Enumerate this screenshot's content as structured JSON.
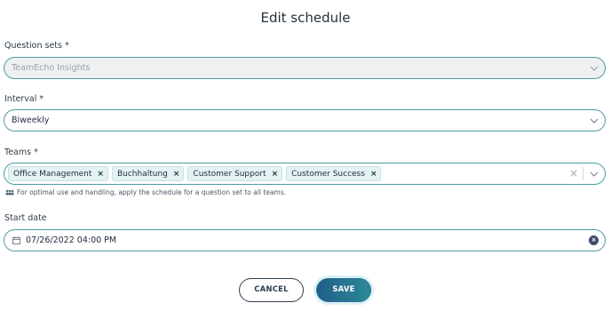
{
  "dialog": {
    "title": "Edit schedule"
  },
  "question_sets": {
    "label": "Question sets *",
    "value": "TeamEcho Insights"
  },
  "interval": {
    "label": "Interval *",
    "value": "Biweekly"
  },
  "teams": {
    "label": "Teams *",
    "chips": [
      "Office Management",
      "Buchhaltung",
      "Customer Support",
      "Customer Success"
    ],
    "remove_glyph": "×",
    "clear_glyph": "×",
    "hint": "For optimal use and handling, apply the schedule for a question set to all teams."
  },
  "start_date": {
    "label": "Start date",
    "value": "07/26/2022 04:00 PM",
    "clear_glyph": "×"
  },
  "actions": {
    "cancel_label": "CANCEL",
    "save_label": "SAVE"
  },
  "colors": {
    "accent_border": "#4a9da3",
    "save_gradient_start": "#1f5e8a",
    "save_gradient_end": "#2c8a94",
    "chip_bg": "#e4f2f3"
  },
  "icons": {
    "dropdown": "chevron-down-icon",
    "calendar": "calendar-icon",
    "team_hint": "people-icon",
    "clear": "clear-circle-icon"
  }
}
